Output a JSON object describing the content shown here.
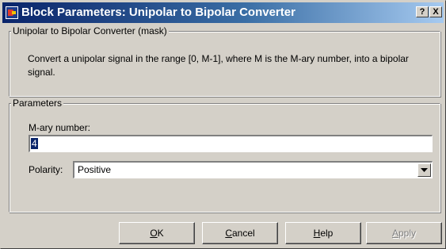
{
  "window": {
    "title": "Block Parameters: Unipolar to Bipolar Converter",
    "help_glyph": "?",
    "close_glyph": "X",
    "icon": "simulink-block-icon"
  },
  "mask_group": {
    "legend": "Unipolar to Bipolar Converter (mask)",
    "description": "Convert a unipolar signal in the range [0, M-1], where M is the M-ary number,  into a bipolar signal."
  },
  "parameters_group": {
    "legend": "Parameters",
    "mary": {
      "label": "M-ary number:",
      "value": "4"
    },
    "polarity": {
      "label": "Polarity:",
      "selected": "Positive"
    }
  },
  "buttons": {
    "ok": {
      "mnemonic": "O",
      "rest": "K"
    },
    "cancel": {
      "mnemonic": "C",
      "rest": "ancel"
    },
    "help": {
      "mnemonic": "H",
      "rest": "elp"
    },
    "apply": {
      "mnemonic": "A",
      "rest": "pply",
      "disabled": true
    }
  }
}
